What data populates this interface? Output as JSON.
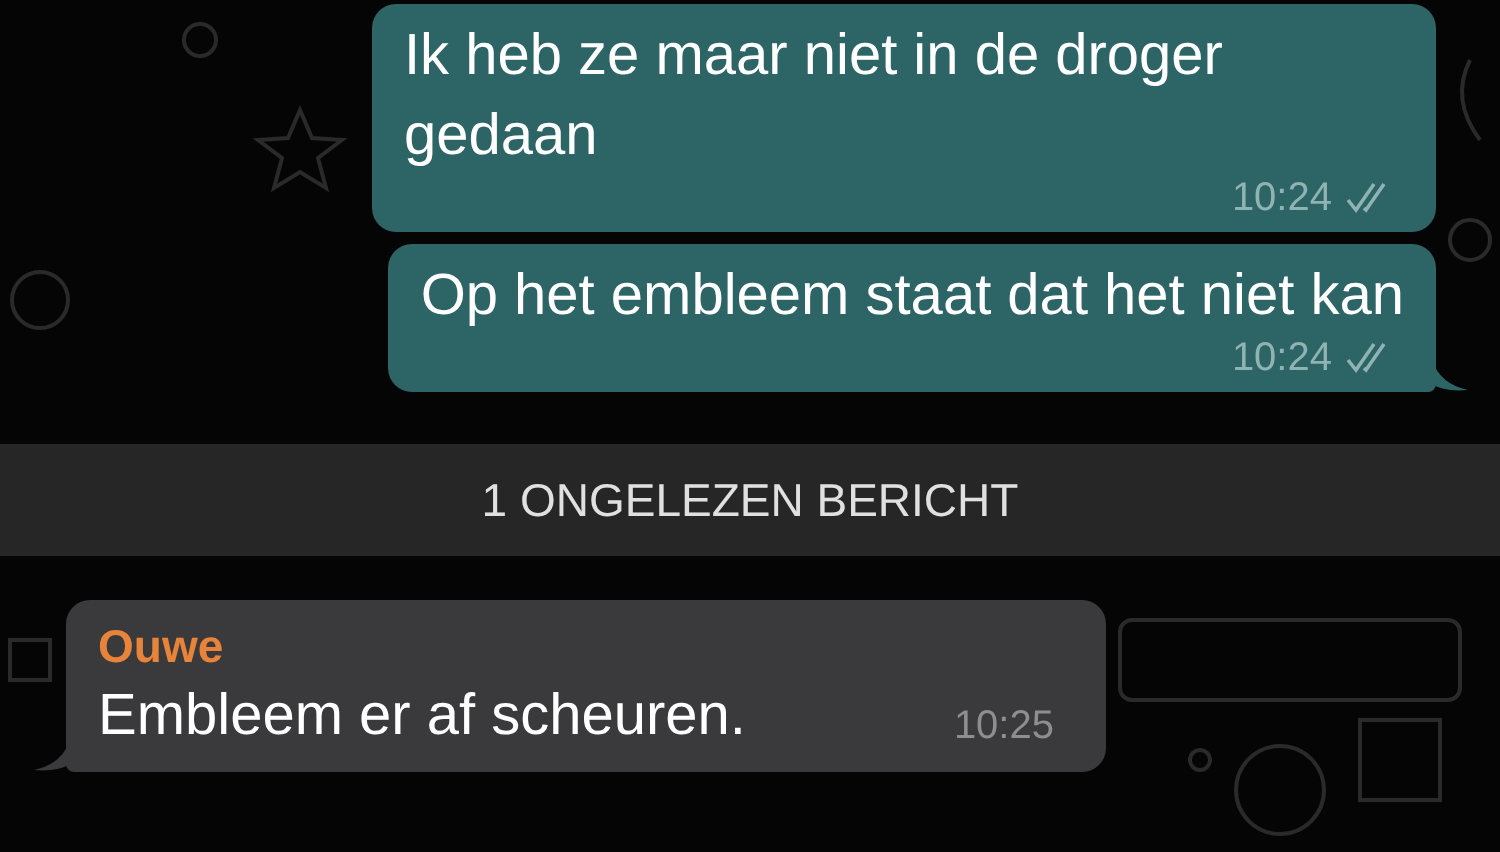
{
  "messages": [
    {
      "kind": "outgoing",
      "text": "Ik heb ze maar niet in de droger gedaan",
      "time": "10:24",
      "read": false,
      "tail": false
    },
    {
      "kind": "outgoing",
      "text": "Op het embleem staat dat het niet kan",
      "time": "10:24",
      "read": false,
      "tail": true
    },
    {
      "kind": "unread_banner",
      "text": "1 ONGELEZEN BERICHT"
    },
    {
      "kind": "incoming",
      "sender": "Ouwe",
      "color": "#e8833a",
      "text": "Embleem er af scheuren.",
      "time": "10:25",
      "tail": true
    }
  ]
}
